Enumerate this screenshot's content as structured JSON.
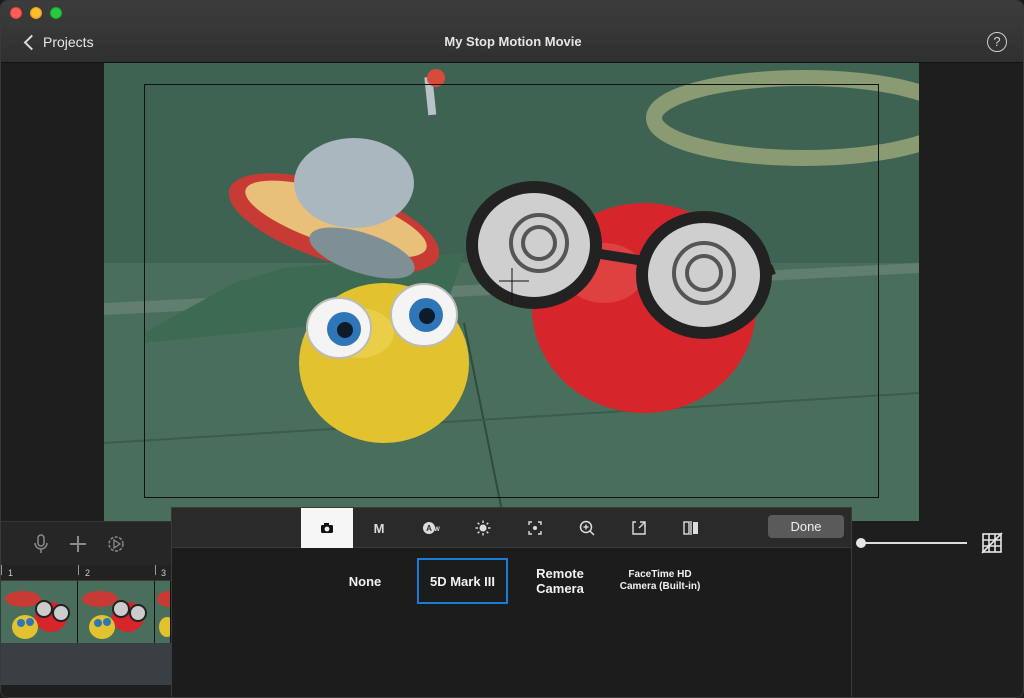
{
  "window": {
    "title": "My Stop Motion Movie",
    "back_label": "Projects",
    "help_glyph": "?"
  },
  "toolbar": {
    "icons": [
      "microphone-icon",
      "plus-icon",
      "settings-gear-icon"
    ]
  },
  "timeline": {
    "ruler_labels": [
      "1",
      "2",
      "3"
    ]
  },
  "camera_popover": {
    "tabs": [
      {
        "name": "camera-icon",
        "label": ""
      },
      {
        "name": "manual",
        "label": "M"
      },
      {
        "name": "auto-white-balance-icon",
        "label": "A"
      },
      {
        "name": "brightness-icon",
        "label": "☼"
      },
      {
        "name": "focus-icon",
        "label": ""
      },
      {
        "name": "zoom-icon",
        "label": ""
      },
      {
        "name": "import-icon",
        "label": ""
      },
      {
        "name": "mirror-icon",
        "label": ""
      }
    ],
    "done_label": "Done",
    "sources": [
      {
        "label": "None"
      },
      {
        "label": "5D Mark III",
        "selected": true
      },
      {
        "label_line1": "Remote",
        "label_line2": "Camera"
      },
      {
        "label_line1": "FaceTime HD",
        "label_line2": "Camera (Built-in)"
      }
    ]
  },
  "overlay": {
    "opacity_slider_value": 0
  },
  "colors": {
    "selection_blue": "#1c7cd5",
    "active_tab_bg": "#f6f6f6"
  }
}
